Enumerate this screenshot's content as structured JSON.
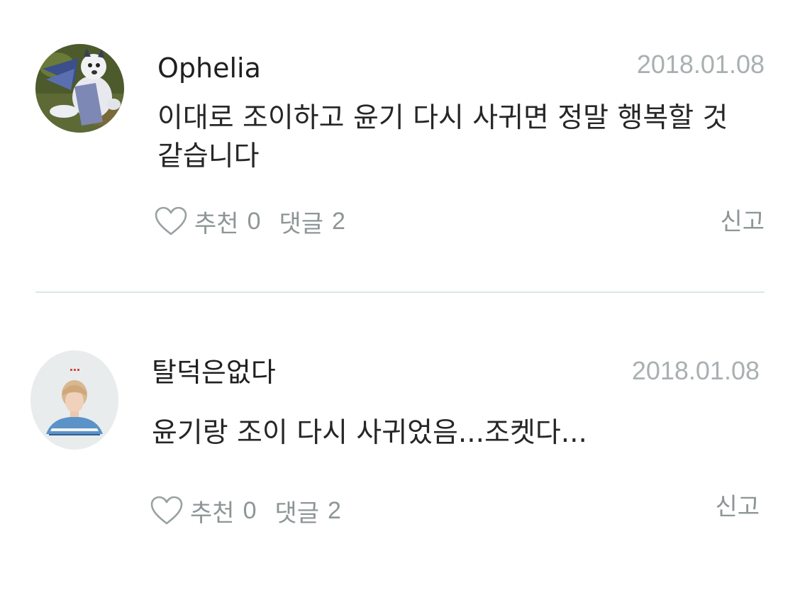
{
  "comments": [
    {
      "username": "Ophelia",
      "date": "2018.01.08",
      "text": "이대로 조이하고 윤기 다시 사귀면 정말 행복할 것 같습니다",
      "like_label": "추천",
      "like_count": "0",
      "reply_label": "댓글",
      "reply_count": "2",
      "report_label": "신고",
      "avatar_icon": "wolf-plush-avatar-icon"
    },
    {
      "username": "탈덕은없다",
      "date": "2018.01.08",
      "text": "윤기랑 조이 다시 사귀었음...조켓다...",
      "like_label": "추천",
      "like_count": "0",
      "reply_label": "댓글",
      "reply_count": "2",
      "report_label": "신고",
      "avatar_icon": "person-avatar-icon"
    }
  ],
  "colors": {
    "text": "#262626",
    "meta": "#8e9597",
    "date": "#a9b0b2",
    "divider": "#dbe7ea"
  }
}
